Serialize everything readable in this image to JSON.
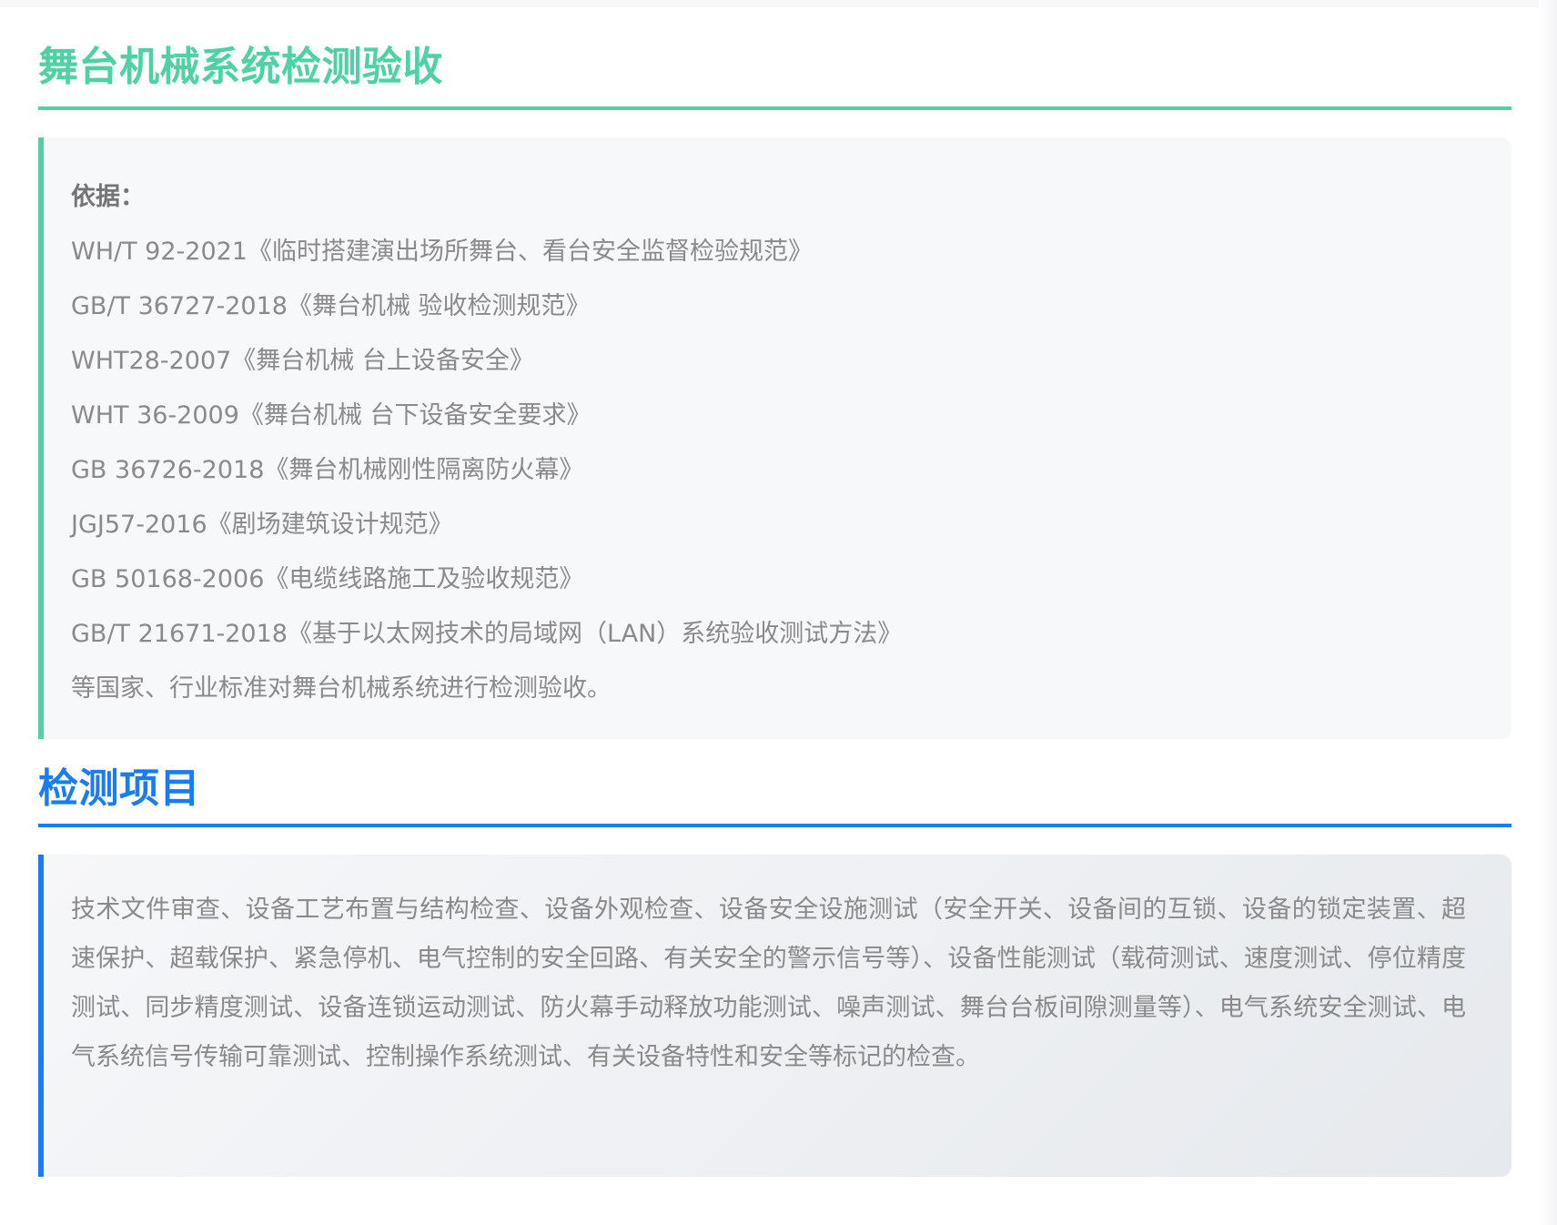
{
  "section1": {
    "title": "舞台机械系统检测验收",
    "basis_label": "依据：",
    "standards": [
      "WH/T 92-2021《临时搭建演出场所舞台、看台安全监督检验规范》",
      "GB/T 36727-2018《舞台机械 验收检测规范》",
      "WHT28-2007《舞台机械 台上设备安全》",
      "WHT 36-2009《舞台机械 台下设备安全要求》",
      "GB 36726-2018《舞台机械刚性隔离防火幕》",
      "JGJ57-2016《剧场建筑设计规范》",
      "GB 50168-2006《电缆线路施工及验收规范》",
      "GB/T 21671-2018《基于以太网技术的局域网（LAN）系统验收测试方法》",
      "等国家、行业标准对舞台机械系统进行检测验收。"
    ],
    "accent_color": "#4fd1a5"
  },
  "section2": {
    "title": "检测项目",
    "body": "技术文件审查、设备工艺布置与结构检查、设备外观检查、设备安全设施测试（安全开关、设备间的互锁、设备的锁定装置、超速保护、超载保护、紧急停机、电气控制的安全回路、有关安全的警示信号等）、设备性能测试（载荷测试、速度测试、停位精度测试、同步精度测试、设备连锁运动测试、防火幕手动释放功能测试、噪声测试、舞台台板间隙测量等）、电气系统安全测试、电气系统信号传输可靠测试、控制操作系统测试、有关设备特性和安全等标记的检查。",
    "accent_color": "#1a7cf0"
  }
}
